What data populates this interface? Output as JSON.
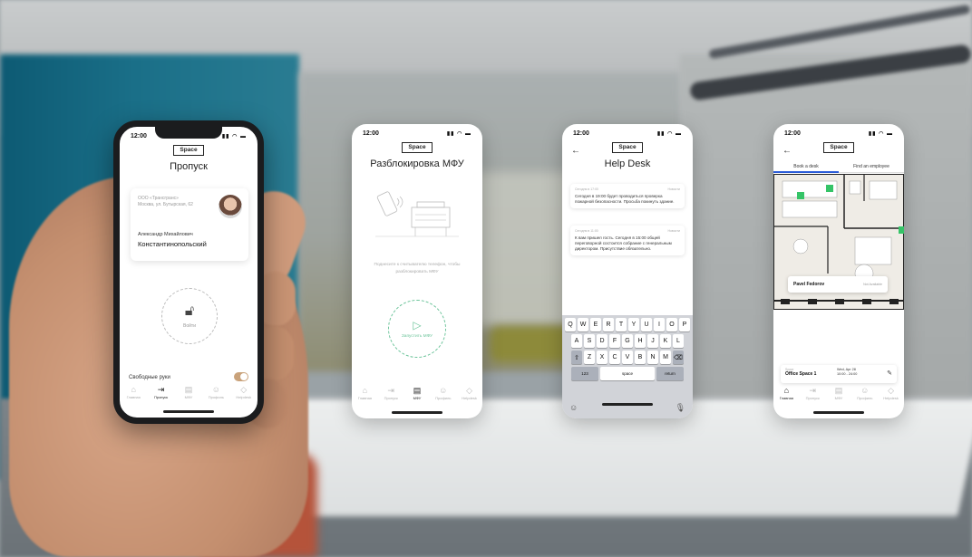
{
  "phone1": {
    "time": "12:00",
    "logo": "Space",
    "title": "Пропуск",
    "org_line1": "ООО «Трансгранс»",
    "org_line2": "Москва, ул. Бутырская, 62",
    "first_name": "Александр Михайлович",
    "last_name": "Константинопольский",
    "unlock_label": "Войти",
    "hands_free_label": "Свободные руки",
    "hands_free_on": true,
    "tabs": [
      "Главная",
      "Пропуск",
      "МФУ",
      "Профиль",
      "Helpdesk"
    ],
    "active_tab": 1
  },
  "phone2": {
    "time": "12:00",
    "logo": "Space",
    "title": "Разблокировка МФУ",
    "hint": "Поднесите к считывателю телефон, чтобы разблокировать МФУ",
    "start_label": "Запустить МФУ",
    "tabs": [
      "Главная",
      "Пропуск",
      "МФУ",
      "Профиль",
      "Helpdesk"
    ],
    "active_tab": 2
  },
  "phone3": {
    "time": "12:00",
    "logo": "Space",
    "title": "Help Desk",
    "messages": [
      {
        "meta_left": "Сегодня в 17:00",
        "meta_right": "Новости",
        "body": "Сегодня в 19:00 будет проводиться проверка пожарной безопасности. Просьба покинуть здание."
      },
      {
        "meta_left": "Сегодня в 11:00",
        "meta_right": "Новости",
        "body": "К вам пришел гость. Сегодня в 15:00 общей переговорной состоится собрание с генеральным директором. Присутствие обязательно."
      }
    ],
    "keyboard": {
      "row1": [
        "Q",
        "W",
        "E",
        "R",
        "T",
        "Y",
        "U",
        "I",
        "O",
        "P"
      ],
      "row2": [
        "A",
        "S",
        "D",
        "F",
        "G",
        "H",
        "J",
        "K",
        "L"
      ],
      "row3": [
        "Z",
        "X",
        "C",
        "V",
        "B",
        "N",
        "M"
      ],
      "num_key": "123",
      "space_key": "space",
      "return_key": "return"
    }
  },
  "phone4": {
    "time": "12:00",
    "logo": "Space",
    "tab_book": "Book a desk",
    "tab_find": "Find an employee",
    "popup_name": "Pavel Fedorov",
    "popup_status": "Not Available",
    "booking_label": "Space",
    "booking_space": "Office Space 1",
    "booking_date": "Wed, Apr 28",
    "booking_time": "10:00 - 24:00",
    "tabs": [
      "Главная",
      "Пропуск",
      "МФУ",
      "Профиль",
      "Helpdesk"
    ],
    "active_tab": 0,
    "accent_color": "#2a5bd7",
    "desk_color": "#35c467"
  }
}
